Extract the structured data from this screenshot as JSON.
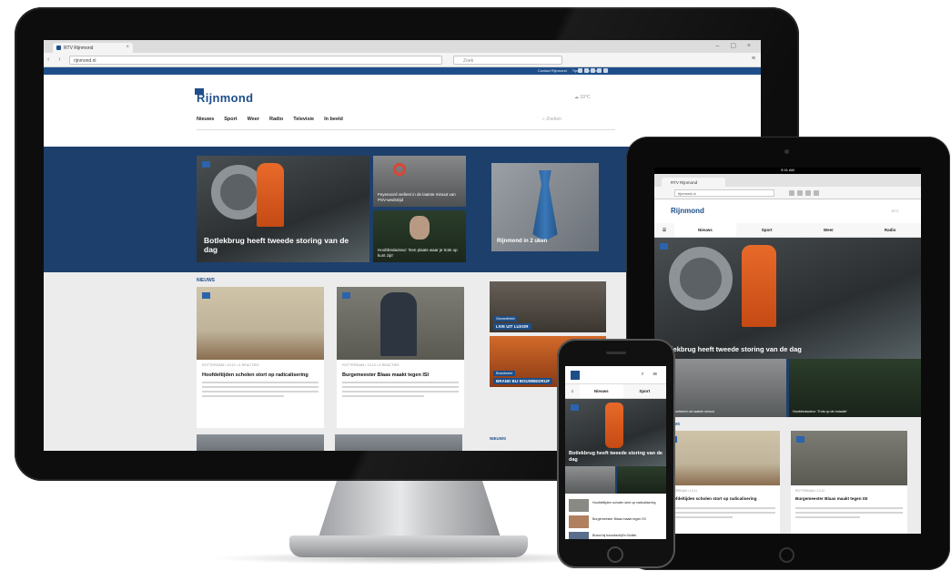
{
  "desktop": {
    "browser": {
      "tab_title": "RTV Rijnmond",
      "url": "rijnmond.nl",
      "search_placeholder": "Zoek"
    },
    "topbar": {
      "links": [
        "Contact Rijnmond",
        "Tips",
        "Contact"
      ]
    },
    "logo": "Rijnmond",
    "weather": "10°C",
    "nav": [
      "Nieuws",
      "Sport",
      "Weer",
      "Radio",
      "Televisie",
      "In beeld"
    ],
    "site_search_placeholder": "Zoeken",
    "hero": {
      "main_caption": "Botlekbrug heeft tweede storing van de dag",
      "small_top_caption": "Feyenoord verliest in de laatste minuut van PSV-wedstrijd",
      "small_bottom_caption": "Hoofdredacteur: 'Een plaats waar je trots op kunt zijn'",
      "right_caption": "Rijnmond in 2 uken"
    },
    "content": {
      "section_label": "NIEUWS",
      "cards": [
        {
          "meta": "ROTTERDAM • 10:21 • 4 REACTIES",
          "title": "Hoofdeltijden scholen stort op radicalisering"
        },
        {
          "meta": "ROTTERDAM • 10:12 • 6 REACTIES",
          "title": "Burgemeester Blaas maakt tegen ISI"
        }
      ],
      "side": [
        {
          "label": "Gezondheid",
          "caption": "LIVE UIT LUXOR"
        },
        {
          "label": "Brandweer",
          "caption": "BRAND BIJ BOUWBEDRIJF"
        }
      ],
      "section_label_2": "NIEUWS"
    }
  },
  "tablet": {
    "status": "9:41 AM",
    "tab_title": "RTV Rijnmond",
    "url": "rijnmond.nl",
    "logo": "Rijnmond",
    "weather": "10°C",
    "nav": [
      "Nieuws",
      "Sport",
      "Weer",
      "Radio"
    ],
    "hero_caption": "Botlekbrug heeft tweede storing van de dag",
    "row_captions": [
      "Feyenoord verliest in de laatste minuut",
      "Hoofdredacteur: 'Trots op de redactie'"
    ],
    "section_label": "NIEUWS",
    "cards": [
      {
        "meta": "ROTTERDAM • 10:21",
        "title": "Hoofdeltijden scholen stort op radicalisering"
      },
      {
        "meta": "ROTTERDAM • 10:12",
        "title": "Burgemeester Blaas maakt tegen ISI"
      }
    ]
  },
  "phone": {
    "nav": [
      "Nieuws",
      "Sport"
    ],
    "hero_caption": "Botlekbrug heeft tweede storing van de dag",
    "list": [
      "Hoofdeltijden scholen stort op radicalisering",
      "Burgemeester Blaas maakt tegen ISI",
      "Brand bij bouwbedrijf in Botlek"
    ]
  }
}
